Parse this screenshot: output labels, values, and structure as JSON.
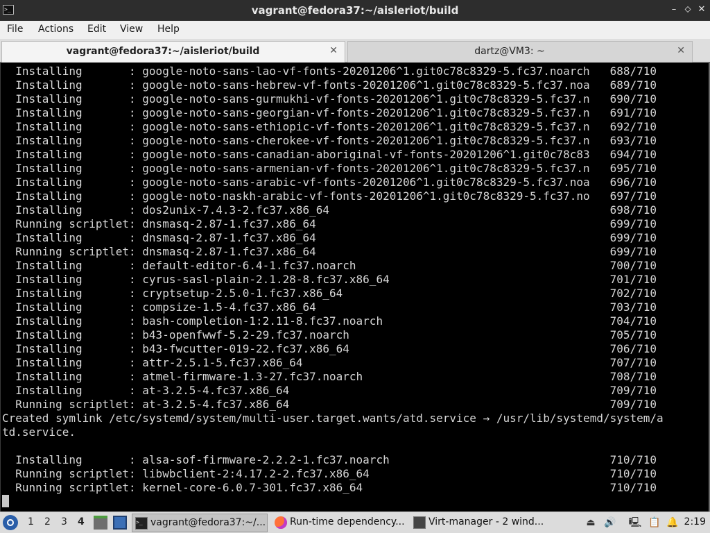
{
  "window": {
    "title": "vagrant@fedora37:~/aisleriot/build",
    "app_icon": "terminal-icon",
    "controls": {
      "minimize": "–",
      "maximize": "⬦",
      "close": "✕"
    }
  },
  "menu": {
    "file": "File",
    "actions": "Actions",
    "edit": "Edit",
    "view": "View",
    "help": "Help"
  },
  "tabs": [
    {
      "label": "vagrant@fedora37:~/aisleriot/build",
      "close": "✕",
      "active": true
    },
    {
      "label": "dartz@VM3: ~",
      "close": "✕",
      "active": false
    }
  ],
  "terminal": {
    "lines": [
      "  Installing       : google-noto-sans-lao-vf-fonts-20201206^1.git0c78c8329-5.fc37.noarch   688/710",
      "  Installing       : google-noto-sans-hebrew-vf-fonts-20201206^1.git0c78c8329-5.fc37.noa   689/710",
      "  Installing       : google-noto-sans-gurmukhi-vf-fonts-20201206^1.git0c78c8329-5.fc37.n   690/710",
      "  Installing       : google-noto-sans-georgian-vf-fonts-20201206^1.git0c78c8329-5.fc37.n   691/710",
      "  Installing       : google-noto-sans-ethiopic-vf-fonts-20201206^1.git0c78c8329-5.fc37.n   692/710",
      "  Installing       : google-noto-sans-cherokee-vf-fonts-20201206^1.git0c78c8329-5.fc37.n   693/710",
      "  Installing       : google-noto-sans-canadian-aboriginal-vf-fonts-20201206^1.git0c78c83   694/710",
      "  Installing       : google-noto-sans-armenian-vf-fonts-20201206^1.git0c78c8329-5.fc37.n   695/710",
      "  Installing       : google-noto-sans-arabic-vf-fonts-20201206^1.git0c78c8329-5.fc37.noa   696/710",
      "  Installing       : google-noto-naskh-arabic-vf-fonts-20201206^1.git0c78c8329-5.fc37.no   697/710",
      "  Installing       : dos2unix-7.4.3-2.fc37.x86_64                                          698/710",
      "  Running scriptlet: dnsmasq-2.87-1.fc37.x86_64                                            699/710",
      "  Installing       : dnsmasq-2.87-1.fc37.x86_64                                            699/710",
      "  Running scriptlet: dnsmasq-2.87-1.fc37.x86_64                                            699/710",
      "  Installing       : default-editor-6.4-1.fc37.noarch                                      700/710",
      "  Installing       : cyrus-sasl-plain-2.1.28-8.fc37.x86_64                                 701/710",
      "  Installing       : cryptsetup-2.5.0-1.fc37.x86_64                                        702/710",
      "  Installing       : compsize-1.5-4.fc37.x86_64                                            703/710",
      "  Installing       : bash-completion-1:2.11-8.fc37.noarch                                  704/710",
      "  Installing       : b43-openfwwf-5.2-29.fc37.noarch                                       705/710",
      "  Installing       : b43-fwcutter-019-22.fc37.x86_64                                       706/710",
      "  Installing       : attr-2.5.1-5.fc37.x86_64                                              707/710",
      "  Installing       : atmel-firmware-1.3-27.fc37.noarch                                     708/710",
      "  Installing       : at-3.2.5-4.fc37.x86_64                                                709/710",
      "  Running scriptlet: at-3.2.5-4.fc37.x86_64                                                709/710",
      "Created symlink /etc/systemd/system/multi-user.target.wants/atd.service → /usr/lib/systemd/system/a",
      "td.service.",
      "",
      "  Installing       : alsa-sof-firmware-2.2.2-1.fc37.noarch                                 710/710",
      "  Running scriptlet: libwbclient-2:4.17.2-2.fc37.x86_64                                    710/710",
      "  Running scriptlet: kernel-core-6.0.7-301.fc37.x86_64                                     710/710"
    ]
  },
  "taskbar": {
    "workspaces": [
      "1",
      "2",
      "3",
      "4"
    ],
    "active_workspace": "4",
    "tasks": [
      {
        "label": "vagrant@fedora37:~/...",
        "icon": "terminal-icon"
      },
      {
        "label": "Run-time dependency...",
        "icon": "firefox-icon"
      },
      {
        "label": "Virt-manager - 2 wind...",
        "icon": "virt-manager-icon"
      }
    ],
    "tray_icons": [
      "eject-icon",
      "volume-icon",
      "network-icon",
      "clipboard-icon",
      "notification-icon"
    ],
    "clock": "2:19"
  }
}
